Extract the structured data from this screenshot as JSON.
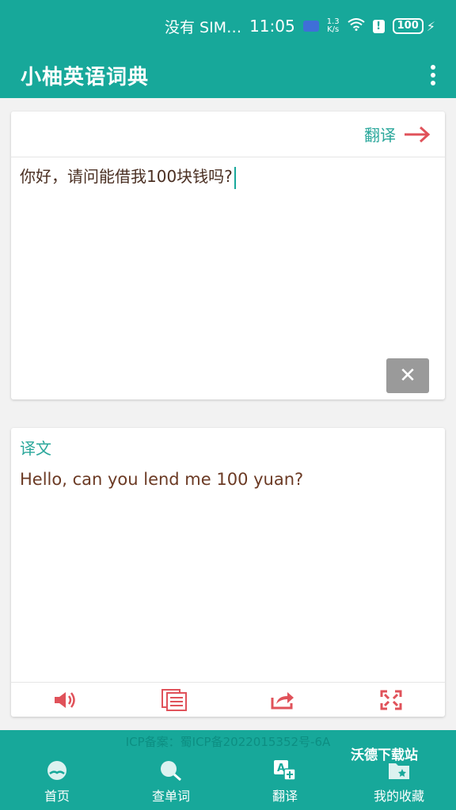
{
  "status_bar": {
    "carrier": "没有 SIM…",
    "time": "11:05",
    "speed_top": "1.3",
    "speed_bottom": "K/s",
    "battery": "100"
  },
  "app_bar": {
    "title": "小柚英语词典",
    "menu_icon": "more-vertical-icon"
  },
  "input_card": {
    "action_label": "翻译",
    "action_icon": "arrow-right-icon",
    "text": "你好，请问能借我100块钱吗?",
    "clear_icon": "close-icon"
  },
  "output_card": {
    "label": "译文",
    "text": "Hello, can you lend me 100 yuan?",
    "tools": [
      "speaker-icon",
      "copy-icon",
      "share-icon",
      "fullscreen-icon"
    ]
  },
  "footer": {
    "icp": "ICP备案：蜀ICP备2022015352号-6A",
    "watermark": "沃德下载站"
  },
  "tabs": [
    {
      "label": "首页",
      "icon": "home-book-icon"
    },
    {
      "label": "查单词",
      "icon": "search-word-icon"
    },
    {
      "label": "翻译",
      "icon": "translate-icon",
      "active": true
    },
    {
      "label": "我的收藏",
      "icon": "favorites-folder-icon"
    }
  ],
  "colors": {
    "primary": "#17a89a",
    "accent_red": "#e0525a",
    "teal_text": "#2aa79b",
    "output_text": "#6b3a24"
  }
}
